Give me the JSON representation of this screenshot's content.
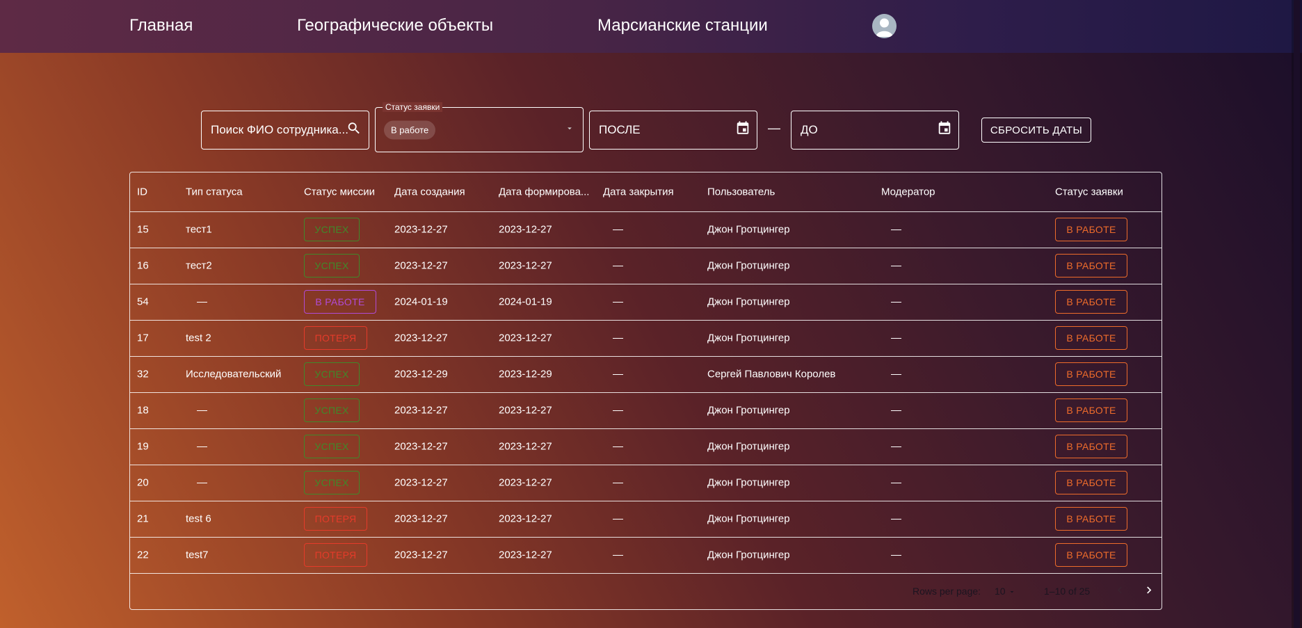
{
  "nav": {
    "home": "Главная",
    "geo_objects": "Географические объекты",
    "mars_stations": "Марсианские станции"
  },
  "filters": {
    "search_placeholder": "Поиск ФИО сотрудника...",
    "status_label": "Статус заявки",
    "status_chip": "В работе",
    "after_placeholder": "ПОСЛЕ",
    "dash": "—",
    "before_placeholder": "ДО",
    "reset_label": "СБРОСИТЬ ДАТЫ"
  },
  "table": {
    "columns": [
      "ID",
      "Тип статуса",
      "Статус миссии",
      "Дата создания",
      "Дата формирова...",
      "Дата закрытия",
      "Пользователь",
      "Модератор",
      "Статус заявки"
    ],
    "rows": [
      {
        "id": "15",
        "type": "тест1",
        "mission": "УСПЕХ",
        "mission_kind": "success",
        "created": "2023-12-27",
        "formed": "2023-12-27",
        "closed": "—",
        "user": "Джон Гротцингер",
        "moderator": "—",
        "status": "В РАБОТЕ"
      },
      {
        "id": "16",
        "type": "тест2",
        "mission": "УСПЕХ",
        "mission_kind": "success",
        "created": "2023-12-27",
        "formed": "2023-12-27",
        "closed": "—",
        "user": "Джон Гротцингер",
        "moderator": "—",
        "status": "В РАБОТЕ"
      },
      {
        "id": "54",
        "type": "—",
        "mission": "В РАБОТЕ",
        "mission_kind": "work",
        "created": "2024-01-19",
        "formed": "2024-01-19",
        "closed": "—",
        "user": "Джон Гротцингер",
        "moderator": "—",
        "status": "В РАБОТЕ"
      },
      {
        "id": "17",
        "type": "test 2",
        "mission": "ПОТЕРЯ",
        "mission_kind": "loss",
        "created": "2023-12-27",
        "formed": "2023-12-27",
        "closed": "—",
        "user": "Джон Гротцингер",
        "moderator": "—",
        "status": "В РАБОТЕ"
      },
      {
        "id": "32",
        "type": "Исследовательский",
        "mission": "УСПЕХ",
        "mission_kind": "success",
        "created": "2023-12-29",
        "formed": "2023-12-29",
        "closed": "—",
        "user": "Сергей Павлович Королев",
        "moderator": "—",
        "status": "В РАБОТЕ"
      },
      {
        "id": "18",
        "type": "—",
        "mission": "УСПЕХ",
        "mission_kind": "success",
        "created": "2023-12-27",
        "formed": "2023-12-27",
        "closed": "—",
        "user": "Джон Гротцингер",
        "moderator": "—",
        "status": "В РАБОТЕ"
      },
      {
        "id": "19",
        "type": "—",
        "mission": "УСПЕХ",
        "mission_kind": "success",
        "created": "2023-12-27",
        "formed": "2023-12-27",
        "closed": "—",
        "user": "Джон Гротцингер",
        "moderator": "—",
        "status": "В РАБОТЕ"
      },
      {
        "id": "20",
        "type": "—",
        "mission": "УСПЕХ",
        "mission_kind": "success",
        "created": "2023-12-27",
        "formed": "2023-12-27",
        "closed": "—",
        "user": "Джон Гротцингер",
        "moderator": "—",
        "status": "В РАБОТЕ"
      },
      {
        "id": "21",
        "type": "test 6",
        "mission": "ПОТЕРЯ",
        "mission_kind": "loss",
        "created": "2023-12-27",
        "formed": "2023-12-27",
        "closed": "—",
        "user": "Джон Гротцингер",
        "moderator": "—",
        "status": "В РАБОТЕ"
      },
      {
        "id": "22",
        "type": "test7",
        "mission": "ПОТЕРЯ",
        "mission_kind": "loss",
        "created": "2023-12-27",
        "formed": "2023-12-27",
        "closed": "—",
        "user": "Джон Гротцингер",
        "moderator": "—",
        "status": "В РАБОТЕ"
      }
    ]
  },
  "pagination": {
    "rows_per_page_label": "Rows per page:",
    "rows_per_page_value": "10",
    "range": "1–10 of 25"
  },
  "icons": {
    "search": "search-icon",
    "dropdown": "caret-down-icon",
    "calendar": "calendar-icon",
    "prev": "chevron-left-icon",
    "next": "chevron-right-icon",
    "avatar": "user-avatar-icon"
  },
  "colors": {
    "success": "#3f8a2a",
    "work": "#b04bd6",
    "loss": "#e53b2a",
    "status_work": "#ef6c2b"
  }
}
